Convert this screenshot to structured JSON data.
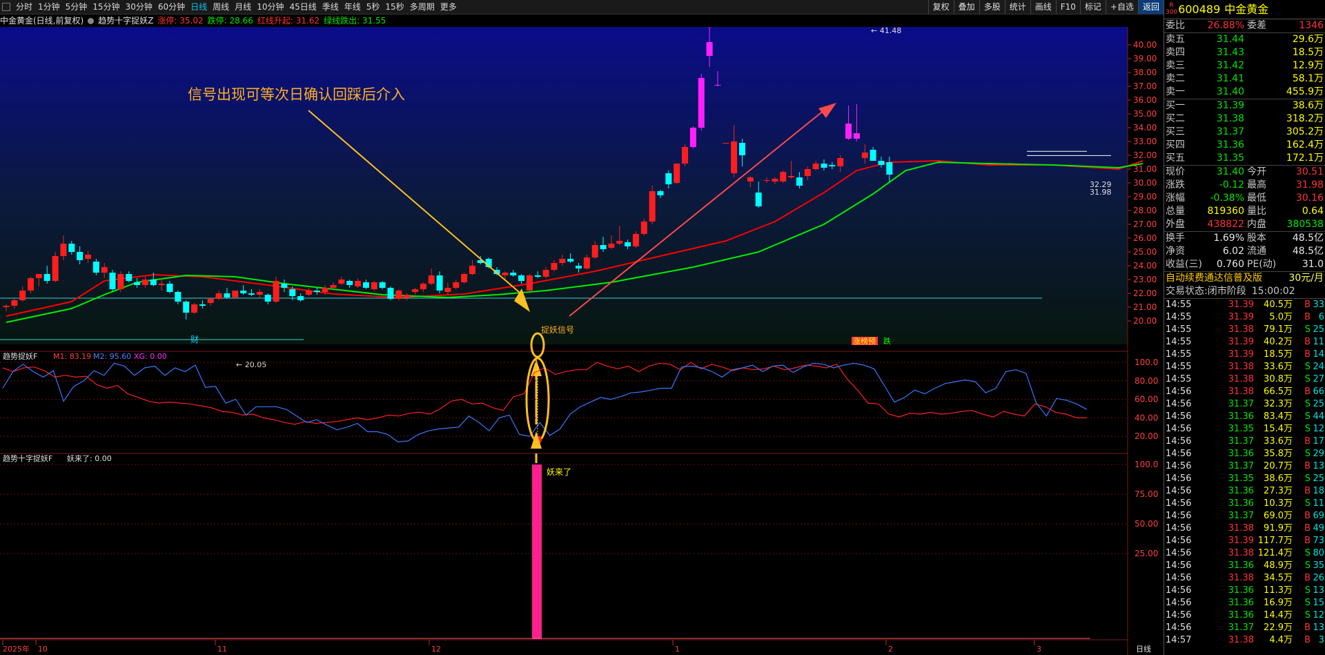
{
  "menu": {
    "periods": [
      "分时",
      "1分钟",
      "5分钟",
      "15分钟",
      "30分钟",
      "60分钟",
      "日线",
      "周线",
      "月线",
      "10分钟",
      "45日线",
      "季线",
      "年线",
      "5秒",
      "15秒",
      "多周期",
      "更多"
    ],
    "active": "日线",
    "right_buttons": [
      "复权",
      "叠加",
      "多股",
      "统计",
      "画线",
      "F10",
      "标记",
      "+自选",
      "返回"
    ]
  },
  "info": {
    "stock": "中金黄金(日线,前复权)",
    "indicator": "趋势十字捉妖Z",
    "items": [
      {
        "label": "涨停: 35.02",
        "color": "#ff3232"
      },
      {
        "label": "跌停: 28.66",
        "color": "#00e600"
      },
      {
        "label": "红线升起: 31.62",
        "color": "#ff3232"
      },
      {
        "label": "绿线跌出: 31.55",
        "color": "#00e600"
      }
    ]
  },
  "annotation": "信号出现可等次日确认回踩后介入",
  "chart_labels": {
    "high": "41.48",
    "low": "20.05",
    "signal": "捉妖信号",
    "cai": "财",
    "zhang": "涨榜预",
    "die": "跌",
    "price_a": "32.29",
    "price_b": "31.98"
  },
  "y_axis_main": [
    "40.00",
    "39.00",
    "38.00",
    "37.00",
    "36.00",
    "35.00",
    "34.00",
    "33.00",
    "32.00",
    "31.00",
    "30.00",
    "29.00",
    "28.00",
    "27.00",
    "26.00",
    "25.00",
    "24.00",
    "23.00",
    "22.00",
    "21.00",
    "20.00"
  ],
  "indicator2": {
    "title": "趋势捉妖F",
    "m1": "M1: 83.19",
    "m2": "M2: 95.60",
    "xg": "XG: 0.00",
    "ticks": [
      "100.0",
      "80.00",
      "60.00",
      "40.00",
      "20.00"
    ]
  },
  "indicator3": {
    "title": "趋势十字捉妖F",
    "value": "妖来了: 0.00",
    "ticks": [
      "100.0",
      "75.00",
      "50.00",
      "25.00"
    ],
    "label": "妖来了"
  },
  "x_axis": [
    "2025年",
    "10",
    "11",
    "12",
    "1",
    "2",
    "3"
  ],
  "x_corner": "日线",
  "chart_data": {
    "type": "candlestick",
    "ylim": [
      19.5,
      41.8
    ],
    "ohlc": [
      [
        21.0,
        21.2,
        20.7,
        21.1
      ],
      [
        21.1,
        21.6,
        20.9,
        21.5
      ],
      [
        21.5,
        22.5,
        21.4,
        22.2
      ],
      [
        22.2,
        23.2,
        22.0,
        23.1
      ],
      [
        23.1,
        23.4,
        22.5,
        23.4
      ],
      [
        23.4,
        24.0,
        22.7,
        22.9
      ],
      [
        22.9,
        25.0,
        22.8,
        24.7
      ],
      [
        24.7,
        26.2,
        24.4,
        25.6
      ],
      [
        25.6,
        25.8,
        24.8,
        25.0
      ],
      [
        25.0,
        25.4,
        24.1,
        24.4
      ],
      [
        24.5,
        25.1,
        24.2,
        24.8
      ],
      [
        24.3,
        24.5,
        23.3,
        23.5
      ],
      [
        23.5,
        24.2,
        23.1,
        23.9
      ],
      [
        23.5,
        23.7,
        22.1,
        22.3
      ],
      [
        22.3,
        23.6,
        22.1,
        23.4
      ],
      [
        23.4,
        23.6,
        22.8,
        22.9
      ],
      [
        22.8,
        23.1,
        22.4,
        22.6
      ],
      [
        22.6,
        23.2,
        22.4,
        23.0
      ],
      [
        23.0,
        23.5,
        22.5,
        22.6
      ],
      [
        22.6,
        23.1,
        22.2,
        22.7
      ],
      [
        22.7,
        22.9,
        22.0,
        22.1
      ],
      [
        22.1,
        22.2,
        21.2,
        21.4
      ],
      [
        21.4,
        21.5,
        20.1,
        20.6
      ],
      [
        20.6,
        21.3,
        20.5,
        21.2
      ],
      [
        21.2,
        21.5,
        20.9,
        21.1
      ],
      [
        21.3,
        21.7,
        21.1,
        21.6
      ],
      [
        21.6,
        22.2,
        21.5,
        22.0
      ],
      [
        22.0,
        22.4,
        21.6,
        21.7
      ],
      [
        21.7,
        22.2,
        21.6,
        22.2
      ],
      [
        22.2,
        22.6,
        21.9,
        22.0
      ],
      [
        22.0,
        22.3,
        21.8,
        21.9
      ],
      [
        21.9,
        22.3,
        21.7,
        22.1
      ],
      [
        21.9,
        22.0,
        21.2,
        21.4
      ],
      [
        21.4,
        23.2,
        21.3,
        22.9
      ],
      [
        22.7,
        23.0,
        22.1,
        22.4
      ],
      [
        22.3,
        22.5,
        21.5,
        21.8
      ],
      [
        21.8,
        22.0,
        21.4,
        21.5
      ],
      [
        21.9,
        22.4,
        21.8,
        22.2
      ],
      [
        22.2,
        22.4,
        21.9,
        22.1
      ],
      [
        22.1,
        22.6,
        21.9,
        22.4
      ],
      [
        22.4,
        22.8,
        22.2,
        22.6
      ],
      [
        22.7,
        23.2,
        22.6,
        23.0
      ],
      [
        22.9,
        23.0,
        22.4,
        22.6
      ],
      [
        22.5,
        23.1,
        22.4,
        22.9
      ],
      [
        22.8,
        23.0,
        22.3,
        22.4
      ],
      [
        22.3,
        22.9,
        22.2,
        22.8
      ],
      [
        22.8,
        22.9,
        22.3,
        22.4
      ],
      [
        22.4,
        22.5,
        21.5,
        21.6
      ],
      [
        21.6,
        22.3,
        21.5,
        22.2
      ],
      [
        21.7,
        22.0,
        21.5,
        21.9
      ],
      [
        22.1,
        22.4,
        21.9,
        22.3
      ],
      [
        22.3,
        22.8,
        22.1,
        22.7
      ],
      [
        22.7,
        23.8,
        22.6,
        23.3
      ],
      [
        23.3,
        23.6,
        22.0,
        22.2
      ],
      [
        22.1,
        22.8,
        21.9,
        22.4
      ],
      [
        22.4,
        23.0,
        22.3,
        22.8
      ],
      [
        22.8,
        23.5,
        22.7,
        23.4
      ],
      [
        23.4,
        24.4,
        23.3,
        24.0
      ],
      [
        24.4,
        24.7,
        24.1,
        24.2
      ],
      [
        24.5,
        24.6,
        23.8,
        23.9
      ],
      [
        23.7,
        23.9,
        23.3,
        23.4
      ],
      [
        23.3,
        23.6,
        23.0,
        23.5
      ],
      [
        23.5,
        23.7,
        23.2,
        23.3
      ],
      [
        23.3,
        23.4,
        22.7,
        22.9
      ],
      [
        22.2,
        23.4,
        22.1,
        23.3
      ],
      [
        23.3,
        23.6,
        23.1,
        23.2
      ],
      [
        23.2,
        23.9,
        23.1,
        23.7
      ],
      [
        23.7,
        24.4,
        23.6,
        24.2
      ],
      [
        24.2,
        24.8,
        24.0,
        24.5
      ],
      [
        24.5,
        24.9,
        24.2,
        24.3
      ],
      [
        24.0,
        24.2,
        23.5,
        23.8
      ],
      [
        23.8,
        24.8,
        23.7,
        24.6
      ],
      [
        24.6,
        25.8,
        24.5,
        25.5
      ],
      [
        25.5,
        26.1,
        25.0,
        25.2
      ],
      [
        25.3,
        26.2,
        25.2,
        25.6
      ],
      [
        25.6,
        26.9,
        25.5,
        25.8
      ],
      [
        25.7,
        25.9,
        25.2,
        25.4
      ],
      [
        25.4,
        26.5,
        25.3,
        26.3
      ],
      [
        26.3,
        27.4,
        26.2,
        27.2
      ],
      [
        27.2,
        29.8,
        27.0,
        29.4
      ],
      [
        29.4,
        29.5,
        28.9,
        29.1
      ],
      [
        30.7,
        30.9,
        29.6,
        29.9
      ],
      [
        30.0,
        31.4,
        29.9,
        31.4
      ],
      [
        31.4,
        32.8,
        31.2,
        32.6
      ],
      [
        32.6,
        34.1,
        32.5,
        34.0
      ],
      [
        34.0,
        37.9,
        33.8,
        37.6
      ],
      [
        39.2,
        41.48,
        38.4,
        40.2
      ],
      [
        37.1,
        38.1,
        37.0,
        37.1
      ],
      [
        32.9,
        32.9,
        32.9,
        32.9
      ],
      [
        30.7,
        34.2,
        30.4,
        33.0
      ],
      [
        32.9,
        33.2,
        31.2,
        32.0
      ],
      [
        30.1,
        30.5,
        29.7,
        30.4
      ],
      [
        29.3,
        30.1,
        28.2,
        28.3
      ],
      [
        30.2,
        30.4,
        30.0,
        30.2
      ],
      [
        30.1,
        30.4,
        29.9,
        30.3
      ],
      [
        30.1,
        30.9,
        30.0,
        30.8
      ],
      [
        30.4,
        31.6,
        30.3,
        30.5
      ],
      [
        30.4,
        30.8,
        29.6,
        29.8
      ],
      [
        30.5,
        31.2,
        30.2,
        31.0
      ],
      [
        31.0,
        31.6,
        30.9,
        31.4
      ],
      [
        31.4,
        31.7,
        30.9,
        31.1
      ],
      [
        31.3,
        31.5,
        31.0,
        31.2
      ],
      [
        31.2,
        32.0,
        30.8,
        31.8
      ],
      [
        34.3,
        35.6,
        33.1,
        33.2
      ],
      [
        33.2,
        35.7,
        33.0,
        33.6
      ],
      [
        31.8,
        32.8,
        31.4,
        32.2
      ],
      [
        32.4,
        32.6,
        31.6,
        31.6
      ],
      [
        31.6,
        31.9,
        31.1,
        31.3
      ],
      [
        31.5,
        31.9,
        30.1,
        30.6
      ]
    ],
    "ma_red": [
      [
        0,
        20.35
      ],
      [
        8,
        21.4
      ],
      [
        12,
        22.9
      ],
      [
        18,
        23.35
      ],
      [
        24,
        23.2
      ],
      [
        32,
        22.6
      ],
      [
        40,
        21.95
      ],
      [
        48,
        21.7
      ],
      [
        56,
        21.95
      ],
      [
        64,
        22.7
      ],
      [
        72,
        23.6
      ],
      [
        80,
        24.7
      ],
      [
        88,
        25.8
      ],
      [
        94,
        27.2
      ],
      [
        100,
        29.3
      ],
      [
        104,
        30.9
      ],
      [
        108,
        31.5
      ],
      [
        114,
        31.6
      ],
      [
        120,
        31.3
      ],
      [
        128,
        31.3
      ],
      [
        136,
        31.0
      ],
      [
        139,
        31.6
      ]
    ],
    "ma_green": [
      [
        0,
        19.9
      ],
      [
        8,
        20.9
      ],
      [
        12,
        21.9
      ],
      [
        16,
        22.8
      ],
      [
        22,
        23.3
      ],
      [
        28,
        23.2
      ],
      [
        34,
        22.7
      ],
      [
        40,
        22.3
      ],
      [
        46,
        21.9
      ],
      [
        54,
        21.7
      ],
      [
        60,
        21.9
      ],
      [
        66,
        22.2
      ],
      [
        74,
        22.8
      ],
      [
        84,
        23.9
      ],
      [
        92,
        25.0
      ],
      [
        100,
        27.0
      ],
      [
        106,
        29.2
      ],
      [
        110,
        30.9
      ],
      [
        114,
        31.5
      ],
      [
        120,
        31.4
      ],
      [
        128,
        31.3
      ],
      [
        136,
        31.1
      ],
      [
        139,
        31.4
      ]
    ],
    "m1": [
      94,
      90,
      94,
      95,
      91,
      84,
      86,
      84,
      85,
      76,
      72,
      75,
      66,
      62,
      58,
      56,
      57,
      56,
      55,
      53,
      51,
      47,
      46,
      43,
      44,
      40,
      38,
      35,
      33,
      36,
      34,
      35,
      36,
      38,
      40,
      38,
      40,
      43,
      42,
      45,
      46,
      44,
      50,
      58,
      60,
      55,
      56,
      51,
      48,
      63,
      66,
      89,
      94,
      87,
      90,
      92,
      92,
      100,
      96,
      93,
      96,
      90,
      96,
      99,
      98,
      92,
      100,
      93,
      98,
      95,
      91,
      94,
      92,
      93,
      96,
      92,
      94,
      97,
      96,
      94,
      98,
      82,
      70,
      56,
      55,
      44,
      41,
      45,
      44,
      46,
      44,
      45,
      47,
      48,
      44,
      41,
      47,
      44,
      42,
      55,
      52,
      46,
      44,
      40,
      40
    ],
    "m2": [
      72,
      90,
      98,
      90,
      84,
      91,
      58,
      74,
      80,
      91,
      86,
      99,
      96,
      86,
      94,
      96,
      86,
      94,
      90,
      97,
      73,
      74,
      56,
      60,
      43,
      52,
      52,
      52,
      49,
      42,
      35,
      38,
      32,
      27,
      30,
      34,
      25,
      25,
      22,
      14,
      15,
      22,
      26,
      28,
      29,
      30,
      42,
      35,
      26,
      40,
      43,
      22,
      20,
      35,
      21,
      28,
      44,
      52,
      57,
      62,
      60,
      63,
      67,
      68,
      70,
      72,
      72,
      95,
      96,
      94,
      90,
      84,
      92,
      94,
      97,
      90,
      96,
      97,
      89,
      95,
      99,
      98,
      94,
      97,
      99,
      97,
      93,
      75,
      57,
      62,
      70,
      66,
      72,
      77,
      79,
      81,
      79,
      67,
      72,
      90,
      92,
      88,
      56,
      42,
      61,
      59,
      55,
      49
    ]
  },
  "quote": {
    "code": "600489",
    "name": "中金黄金",
    "sup": "R",
    "sub": "300",
    "weibi_label": "委比",
    "weibi": "26.88%",
    "weicha_label": "委差",
    "weicha": "1346",
    "asks": [
      {
        "l": "卖五",
        "p": "31.44",
        "v": "29.6万"
      },
      {
        "l": "卖四",
        "p": "31.43",
        "v": "18.5万"
      },
      {
        "l": "卖三",
        "p": "31.42",
        "v": "12.9万"
      },
      {
        "l": "卖二",
        "p": "31.41",
        "v": "58.1万"
      },
      {
        "l": "卖一",
        "p": "31.40",
        "v": "455.9万"
      }
    ],
    "bids": [
      {
        "l": "买一",
        "p": "31.39",
        "v": "38.6万"
      },
      {
        "l": "买二",
        "p": "31.38",
        "v": "318.2万"
      },
      {
        "l": "买三",
        "p": "31.37",
        "v": "305.2万"
      },
      {
        "l": "买四",
        "p": "31.36",
        "v": "162.4万"
      },
      {
        "l": "买五",
        "p": "31.35",
        "v": "172.1万"
      }
    ],
    "stats": [
      [
        {
          "l": "现价",
          "v": "31.40",
          "c": "grn"
        },
        {
          "l": "今开",
          "v": "30.51",
          "c": "red"
        }
      ],
      [
        {
          "l": "涨跌",
          "v": "-0.12",
          "c": "grn"
        },
        {
          "l": "最高",
          "v": "31.98",
          "c": "red"
        }
      ],
      [
        {
          "l": "涨幅",
          "v": "-0.38%",
          "c": "grn"
        },
        {
          "l": "最低",
          "v": "30.16",
          "c": "red"
        }
      ],
      [
        {
          "l": "总量",
          "v": "819360",
          "c": "yel"
        },
        {
          "l": "量比",
          "v": "0.64",
          "c": "yel"
        }
      ],
      [
        {
          "l": "外盘",
          "v": "438822",
          "c": "red"
        },
        {
          "l": "内盘",
          "v": "380538",
          "c": "grn"
        }
      ]
    ],
    "stats2": [
      [
        {
          "l": "换手",
          "v": "1.69%",
          "c": "wht"
        },
        {
          "l": "股本",
          "v": "48.5亿",
          "c": "wht"
        }
      ],
      [
        {
          "l": "净资",
          "v": "6.02",
          "c": "wht"
        },
        {
          "l": "流通",
          "v": "48.5亿",
          "c": "wht"
        }
      ],
      [
        {
          "l": "收益(三)",
          "v": "0.760",
          "c": "wht"
        },
        {
          "l": "PE(动)",
          "v": "31.0",
          "c": "wht"
        }
      ]
    ],
    "promo": "自动续费通达信普及版",
    "promo_price": "30元/月",
    "status_label": "交易状态:",
    "status": "闭市阶段",
    "status_time": "15:00:02"
  },
  "ticks": [
    [
      "14:55",
      "31.39",
      "40.5万",
      "B",
      "33"
    ],
    [
      "14:55",
      "31.39",
      "5.0万",
      "B",
      "6"
    ],
    [
      "14:55",
      "31.38",
      "79.1万",
      "S",
      "25"
    ],
    [
      "14:55",
      "31.39",
      "40.2万",
      "B",
      "11"
    ],
    [
      "14:55",
      "31.39",
      "18.5万",
      "B",
      "14"
    ],
    [
      "14:55",
      "31.38",
      "33.6万",
      "S",
      "24"
    ],
    [
      "14:55",
      "31.38",
      "30.8万",
      "S",
      "27"
    ],
    [
      "14:56",
      "31.38",
      "66.5万",
      "B",
      "66"
    ],
    [
      "14:56",
      "31.37",
      "32.3万",
      "S",
      "25"
    ],
    [
      "14:56",
      "31.36",
      "83.4万",
      "S",
      "44"
    ],
    [
      "14:56",
      "31.35",
      "15.4万",
      "S",
      "12"
    ],
    [
      "14:56",
      "31.37",
      "33.6万",
      "B",
      "17"
    ],
    [
      "14:56",
      "31.36",
      "35.8万",
      "S",
      "29"
    ],
    [
      "14:56",
      "31.37",
      "20.7万",
      "B",
      "13"
    ],
    [
      "14:56",
      "31.35",
      "38.6万",
      "S",
      "25"
    ],
    [
      "14:56",
      "31.36",
      "27.3万",
      "B",
      "18"
    ],
    [
      "14:56",
      "31.36",
      "10.3万",
      "S",
      "11"
    ],
    [
      "14:56",
      "31.37",
      "69.0万",
      "B",
      "69"
    ],
    [
      "14:56",
      "31.38",
      "91.9万",
      "B",
      "49"
    ],
    [
      "14:56",
      "31.39",
      "117.7万",
      "B",
      "73"
    ],
    [
      "14:56",
      "31.38",
      "121.4万",
      "S",
      "80"
    ],
    [
      "14:56",
      "31.36",
      "48.9万",
      "S",
      "35"
    ],
    [
      "14:56",
      "31.38",
      "34.5万",
      "B",
      "26"
    ],
    [
      "14:56",
      "31.36",
      "11.3万",
      "S",
      "13"
    ],
    [
      "14:56",
      "31.36",
      "16.9万",
      "S",
      "15"
    ],
    [
      "14:56",
      "31.36",
      "14.4万",
      "S",
      "12"
    ],
    [
      "14:56",
      "31.37",
      "22.9万",
      "B",
      "13"
    ],
    [
      "14:57",
      "31.38",
      "4.4万",
      "B",
      "3"
    ]
  ],
  "colors": {
    "up": "#ff1e1e",
    "down": "#00ffff",
    "ma_red": "#ff0000",
    "ma_green": "#00ee00",
    "arrow_gold": "#ffc020",
    "arrow_red": "#ff4a4a",
    "signal": "#ff2090"
  }
}
